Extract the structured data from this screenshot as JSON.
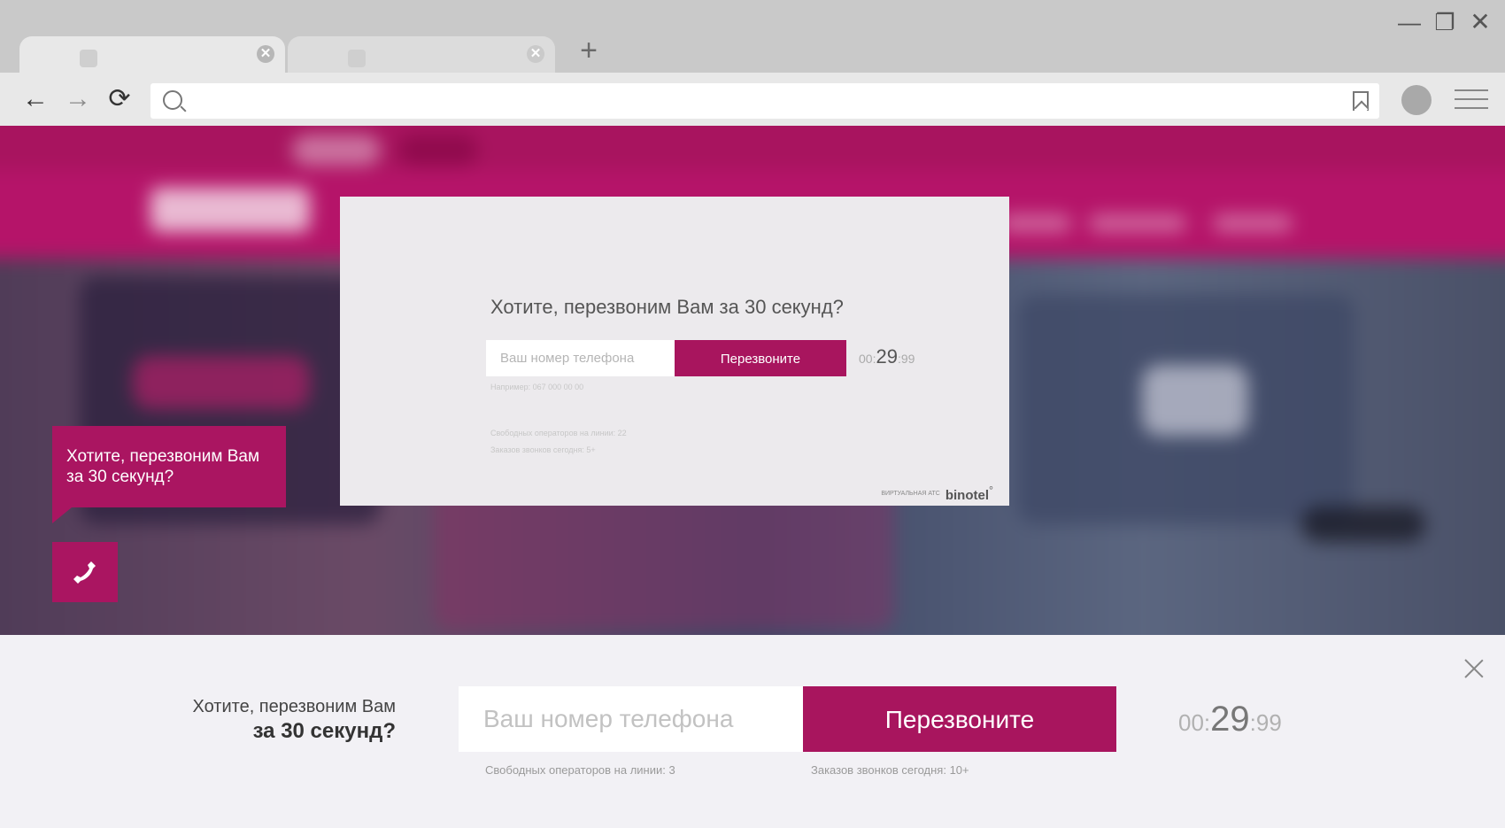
{
  "browser": {
    "tabs": [
      {
        "title": ""
      },
      {
        "title": ""
      }
    ],
    "new_tab_glyph": "+",
    "window_controls": {
      "minimize": "—",
      "maximize": "❐",
      "close": "✕"
    },
    "tab_close_glyph": "✕",
    "nav": {
      "back": "←",
      "forward": "→",
      "reload": "⟳"
    },
    "address": {
      "value": "",
      "placeholder": ""
    }
  },
  "modal": {
    "title": "Хотите, перезвоним Вам за 30 секунд?",
    "phone_placeholder": "Ваш номер телефона",
    "button_label": "Перезвоните",
    "timer": {
      "minutes": "00:",
      "seconds": "29",
      "hundredths": ":99"
    },
    "hint": "Например: 067 000 00 00",
    "free_operators": "Свободных операторов на линии: 22",
    "orders_today": "Заказов звонков сегодня: 5+",
    "brand_caption": "ВИРТУАЛЬНАЯ АТС",
    "brand_logo": "binotel",
    "brand_mark": "°"
  },
  "widget": {
    "bubble_text": "Хотите, перезвоним Вам за 30 секунд?",
    "call_icon": "phone-icon"
  },
  "bottom_bar": {
    "line1": "Хотите, перезвоним Вам",
    "line2": "за 30 секунд?",
    "phone_placeholder": "Ваш номер телефона",
    "button_label": "Перезвоните",
    "timer": {
      "minutes": "00:",
      "seconds": "29",
      "hundredths": ":99"
    },
    "free_operators": "Свободных операторов на линии: 3",
    "orders_today": "Заказов звонков сегодня: 10+"
  },
  "colors": {
    "brand": "#a8155e",
    "chrome_bg": "#c9c9c9",
    "toolbar_bg": "#e8e8e8",
    "bottombar_bg": "#f2f1f5",
    "modal_bg": "#eceaed"
  }
}
